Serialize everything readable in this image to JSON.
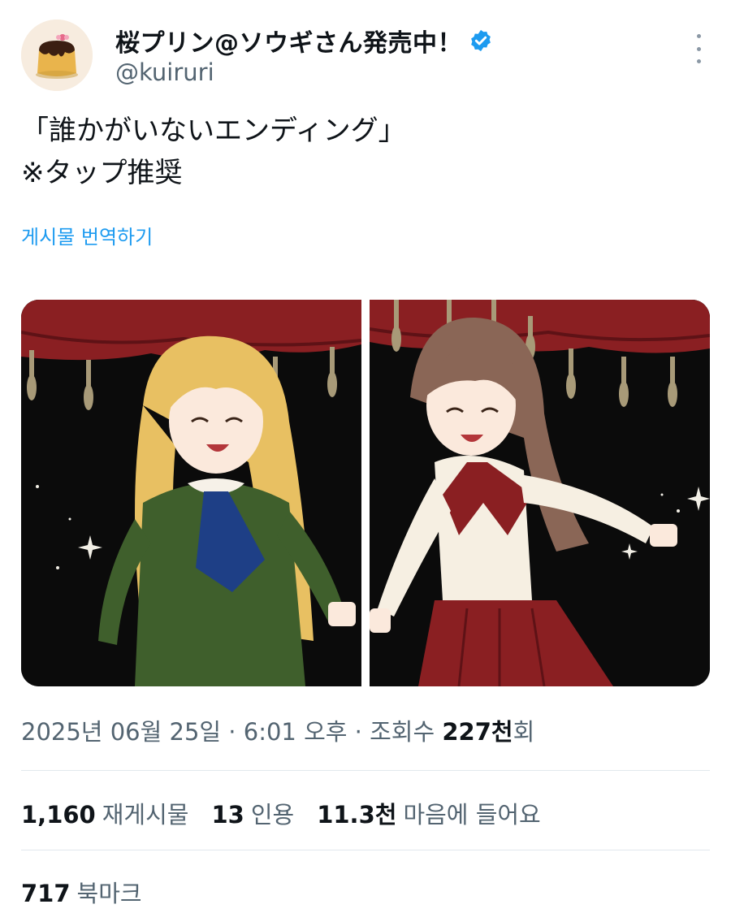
{
  "author": {
    "display_name": "桜プリン@ソウギさん発売中！",
    "handle": "@kuiruri",
    "avatar_icon": "pudding-avatar-icon",
    "verified_icon": "verified-badge-icon"
  },
  "tweet": {
    "line1": "「誰かがいないエンディング」",
    "line2": "※タップ推奨",
    "translate_label": "게시물 번역하기"
  },
  "meta": {
    "date": "2025년 06월 25일",
    "sep1": " · ",
    "time": "6:01 오후",
    "sep2": " · ",
    "views_prefix": "조회수 ",
    "views_count": "227천",
    "views_suffix": "회"
  },
  "stats": {
    "retweets_count": "1,160",
    "retweets_label": "재게시물",
    "quotes_count": "13",
    "quotes_label": "인용",
    "likes_count": "11.3천",
    "likes_label": "마음에 들어요",
    "bookmarks_count": "717",
    "bookmarks_label": "북마크"
  },
  "colors": {
    "link": "#1d9bf0",
    "secondary_text": "#536471",
    "curtain": "#8a1f22"
  }
}
